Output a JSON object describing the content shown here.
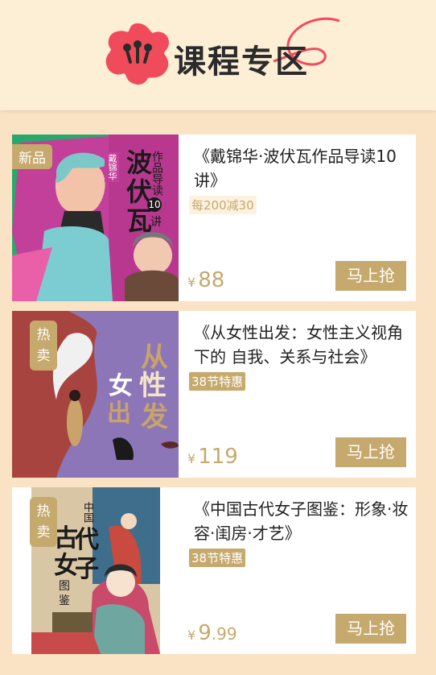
{
  "header": {
    "title": "课程专区",
    "logo_icon": "flower-icon"
  },
  "colors": {
    "accent": "#c6a96d",
    "background": "#fae3c4",
    "header_bg": "#fdeed6",
    "logo_red": "#f04b5a"
  },
  "courses": [
    {
      "badge": "新品",
      "title": "《戴锦华·波伏瓦作品导读10讲》",
      "tag": "每200减30",
      "currency": "¥",
      "price": "88",
      "price_decimal": "",
      "buy_label": "马上抢",
      "cover_text": {
        "main": "波伏瓦",
        "sub": "作品导读",
        "num": "10",
        "unit": "讲",
        "author": "戴锦华"
      }
    },
    {
      "badge": "热卖",
      "title": "《从女性出发：女性主义视角下的 自我、关系与社会》",
      "tag": "38节特惠",
      "currency": "¥",
      "price": "119",
      "price_decimal": "",
      "buy_label": "马上抢",
      "cover_text": {
        "c1": "从",
        "c2": "女",
        "c3": "性",
        "c4": "出",
        "c5": "发"
      }
    },
    {
      "badge": "热卖",
      "title": "《中国古代女子图鉴：形象·妆容·闺房·才艺》",
      "tag": "38节特惠",
      "currency": "¥",
      "price": "9",
      "price_decimal": ".99",
      "buy_label": "马上抢",
      "cover_text": {
        "top": "中国",
        "c1": "古",
        "c2": "代",
        "c3": "女",
        "c4": "子",
        "sub1": "图",
        "sub2": "鉴"
      }
    }
  ]
}
